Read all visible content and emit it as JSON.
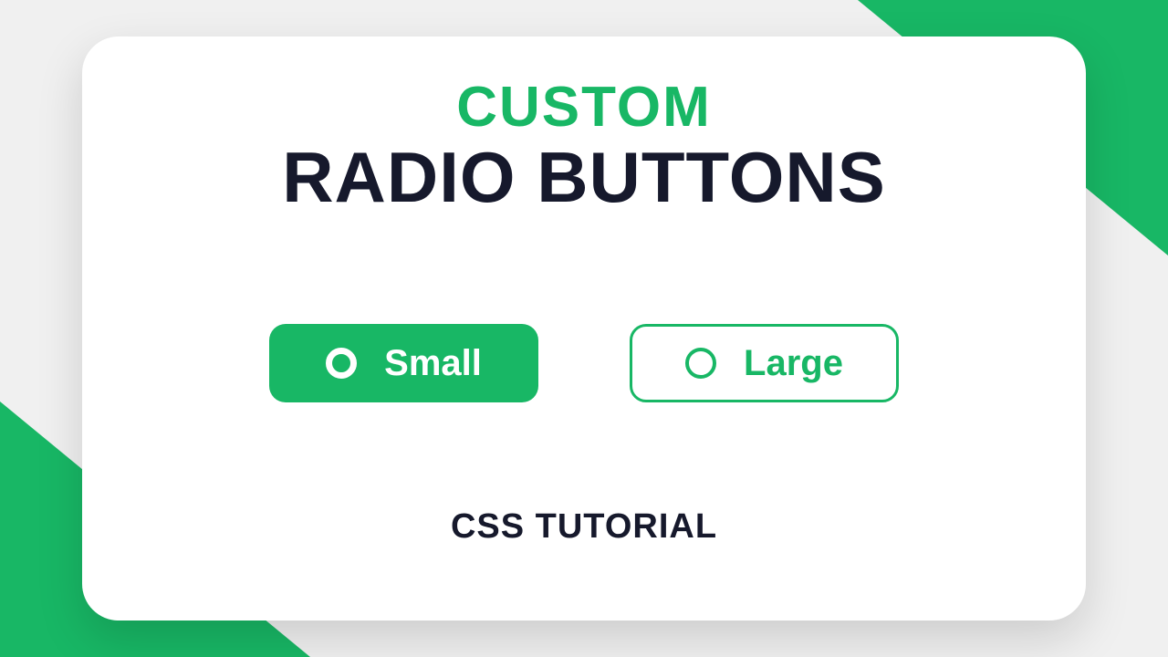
{
  "title": {
    "line1": "CUSTOM",
    "line2": "RADIO BUTTONS"
  },
  "options": {
    "selected": {
      "label": "Small"
    },
    "unselected": {
      "label": "Large"
    }
  },
  "footer": "CSS TUTORIAL",
  "colors": {
    "accent": "#18b765",
    "dark": "#16192c"
  }
}
